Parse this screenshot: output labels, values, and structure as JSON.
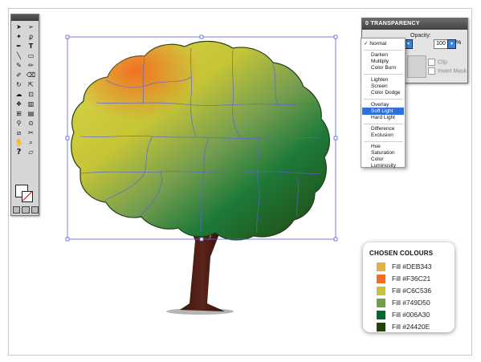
{
  "transparency_panel": {
    "title": "0 TRANSPARENCY",
    "opacity_label": "Opacity:",
    "opacity_value": "100",
    "opacity_unit": "%",
    "clip_label": "Clip",
    "invert_mask_label": "Invert Mask"
  },
  "blend_menu": {
    "selected": "Normal",
    "items": [
      "Darken",
      "Multiply",
      "Color Burn",
      "Lighten",
      "Screen",
      "Color Dodge",
      "Overlay",
      "Soft Light",
      "Hard Light",
      "Difference",
      "Exclusion",
      "Hue",
      "Saturation",
      "Color",
      "Luminosity"
    ],
    "highlighted": "Soft Light"
  },
  "chosen_colours": {
    "title": "CHOSEN COLOURS",
    "items": [
      {
        "label": "Fill  #DEB343",
        "color": "#DEB343"
      },
      {
        "label": "Fill  #F36C21",
        "color": "#F36C21"
      },
      {
        "label": "Fill  #C6C536",
        "color": "#C6C536"
      },
      {
        "label": "Fill  #749D50",
        "color": "#749D50"
      },
      {
        "label": "Fill  #006A30",
        "color": "#006A30"
      },
      {
        "label": "Fill  #24420E",
        "color": "#24420E"
      }
    ]
  },
  "tools": {
    "icons": [
      "selection-tool-icon",
      "direct-selection-tool-icon",
      "magic-wand-icon",
      "lasso-icon",
      "pen-icon",
      "type-icon",
      "line-icon",
      "rectangle-icon",
      "paintbrush-icon",
      "pencil-icon",
      "blob-brush-icon",
      "eraser-icon",
      "rotate-icon",
      "scale-icon",
      "warp-icon",
      "free-transform-icon",
      "symbol-sprayer-icon",
      "graph-icon",
      "mesh-icon",
      "gradient-icon",
      "eyedropper-icon",
      "blend-icon",
      "slice-icon",
      "scissors-icon",
      "hand-icon",
      "zoom-icon"
    ]
  }
}
